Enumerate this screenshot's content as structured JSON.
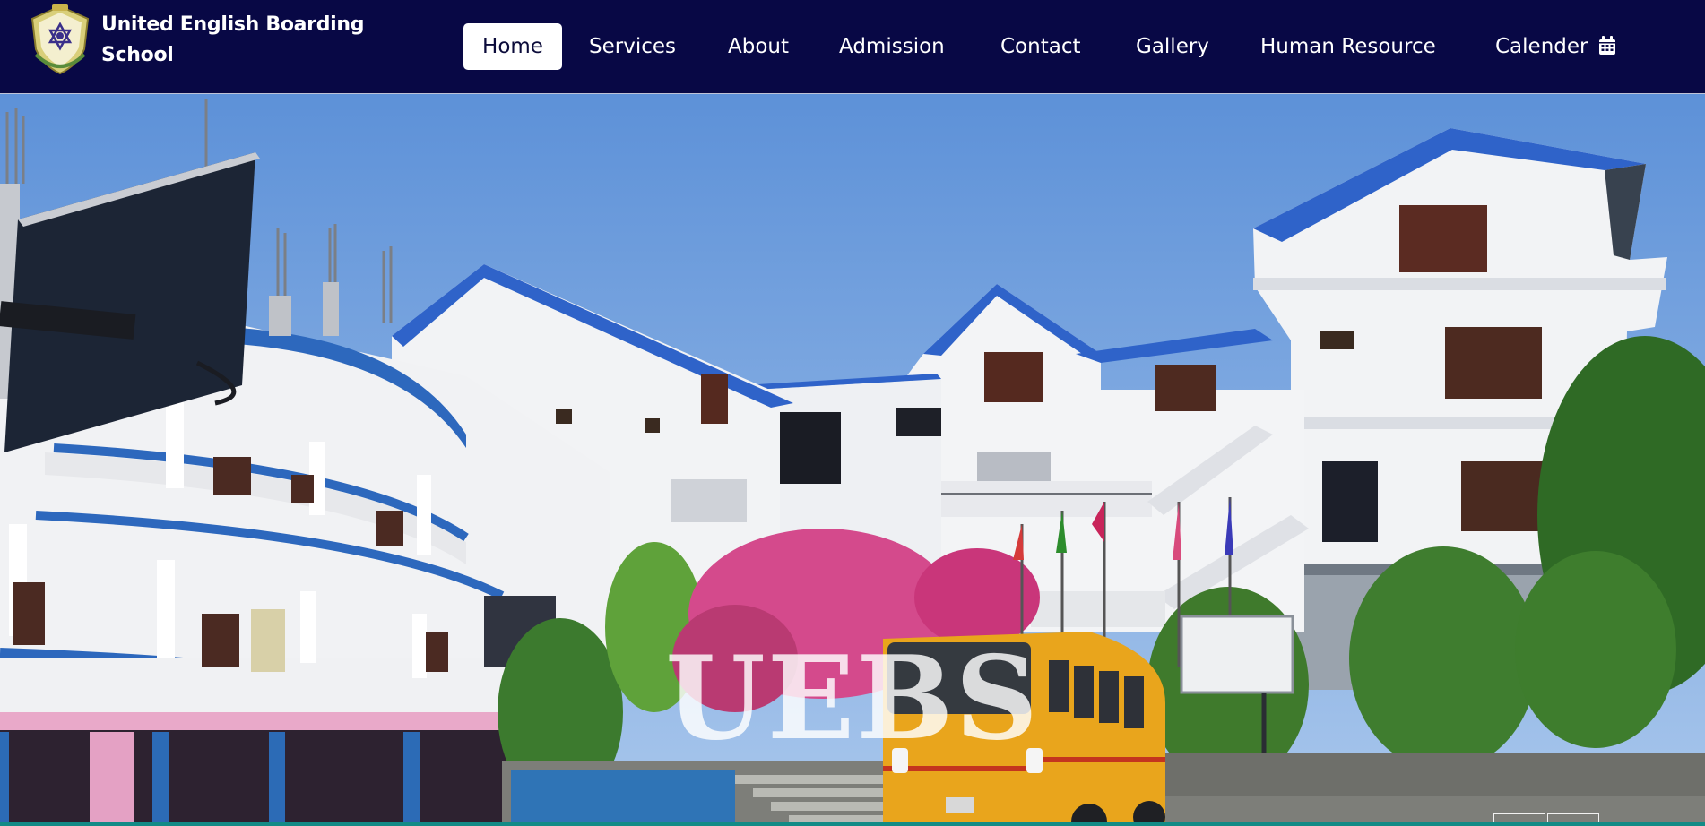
{
  "brand": {
    "line1": "United English Boarding",
    "line2": "School",
    "logo_icon": "school-crest-icon"
  },
  "nav": {
    "items": [
      {
        "label": "Home",
        "active": true
      },
      {
        "label": "Services",
        "active": false
      },
      {
        "label": "About",
        "active": false
      },
      {
        "label": "Admission",
        "active": false
      },
      {
        "label": "Contact",
        "active": false
      },
      {
        "label": "Gallery",
        "active": false
      },
      {
        "label": "Human Resource",
        "active": false
      },
      {
        "label": "Calender",
        "active": false,
        "icon": "calendar-icon"
      }
    ]
  },
  "hero": {
    "title": "UEBS",
    "image_icon": "school-building-photo"
  },
  "colors": {
    "navbar_bg": "#080845",
    "active_tab_bg": "#ffffff",
    "active_tab_text": "#0b0b3a",
    "bottom_bar": "#128b86"
  }
}
